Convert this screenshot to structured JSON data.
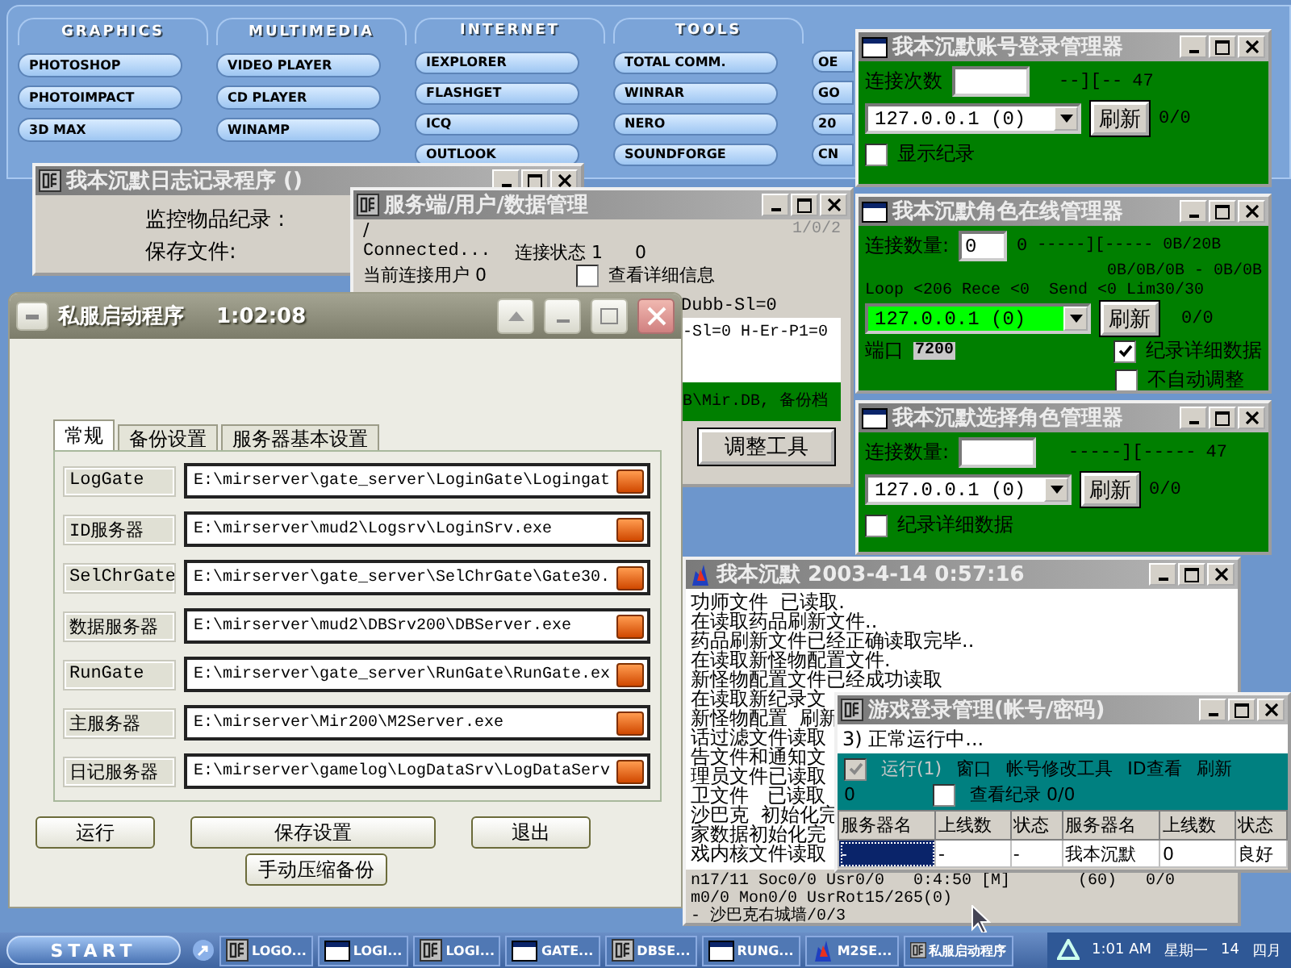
{
  "launcher_menu": [
    {
      "heading": "GRAPHICS",
      "items": [
        "PHOTOSHOP",
        "PHOTOIMPACT",
        "3D MAX"
      ]
    },
    {
      "heading": "MULTIMEDIA",
      "items": [
        "VIDEO PLAYER",
        "CD PLAYER",
        "WINAMP"
      ]
    },
    {
      "heading": "INTERNET",
      "items": [
        "IEXPLORER",
        "FLASHGET",
        "ICQ",
        "OUTLOOK"
      ]
    },
    {
      "heading": "TOOLS",
      "items": [
        "TOTAL COMM.",
        "WINRAR",
        "NERO",
        "SOUNDFORGE"
      ]
    },
    {
      "items": [
        "OE",
        "GO",
        "20",
        "CN"
      ]
    }
  ],
  "log_window": {
    "title": "我本沉默日志记录程序 ()",
    "labels": [
      "监控物品纪录 :",
      "保存文件:"
    ]
  },
  "server_window": {
    "title": "服务端/用户/数据管理",
    "path": "/",
    "counter": "1/0/2",
    "status": "Connected...",
    "connection_state": "连接状态 1",
    "connection_value": "0",
    "current_users": "当前连接用户 0",
    "detail_checkbox": {
      "label": "查看详细信息",
      "checked": false
    },
    "info_line": "Dubb-Sl=0",
    "memo_line": "-Sl=0 H-Er-P1=0",
    "backup_line": "B\\Mir.DB,  备份档",
    "tool_button": "调整工具"
  },
  "launcher_window": {
    "title": "私服启动程序",
    "clock": "1:02:08",
    "tabs": [
      {
        "label": "常规",
        "selected": true
      },
      {
        "label": "备份设置",
        "selected": false
      },
      {
        "label": "服务器基本设置",
        "selected": false
      }
    ],
    "rows": [
      {
        "label": "LogGate",
        "path": "E:\\mirserver\\gate_server\\LoginGate\\Logingat"
      },
      {
        "label": "ID服务器",
        "path": "E:\\mirserver\\mud2\\Logsrv\\LoginSrv.exe"
      },
      {
        "label": "SelChrGate",
        "path": "E:\\mirserver\\gate_server\\SelChrGate\\Gate30."
      },
      {
        "label": "数据服务器",
        "path": "E:\\mirserver\\mud2\\DBSrv200\\DBServer.exe"
      },
      {
        "label": "RunGate",
        "path": "E:\\mirserver\\gate_server\\RunGate\\RunGate.ex"
      },
      {
        "label": "主服务器",
        "path": "E:\\mirserver\\Mir200\\M2Server.exe"
      },
      {
        "label": "日记服务器",
        "path": "E:\\mirserver\\gamelog\\LogDataSrv\\LogDataServ"
      }
    ],
    "buttons": [
      "运行",
      "保存设置",
      "退出"
    ],
    "backup_button": "手动压缩备份"
  },
  "account_window": {
    "title": "我本沉默账号登录管理器",
    "count_label": "连接次数",
    "marker": "--][--",
    "marker_value": "47",
    "address": "127.0.0.1  (0)",
    "refresh": "刷新",
    "ratio": "0/0",
    "log_checkbox": {
      "label": "显示纪录",
      "checked": false
    }
  },
  "role_window": {
    "title": "我本沉默角色在线管理器",
    "count_label": "连接数量:",
    "count_value": "0",
    "count_extra": "0",
    "marker": "-----][----- 0B/20B",
    "traffic": "0B/0B/0B - 0B/0B",
    "loop_line": "Loop <206 Rece <0  Send <0 Lim30/30",
    "address": "127.0.0.1  (0)",
    "address_highlighted": true,
    "refresh": "刷新",
    "ratio": "0/0",
    "port_label": "端口",
    "port_value": "7200",
    "checkboxes": [
      {
        "label": "纪录详细数据",
        "checked": true
      },
      {
        "label": "不自动调整",
        "checked": false
      }
    ]
  },
  "select_window": {
    "title": "我本沉默选择角色管理器",
    "count_label": "连接数量:",
    "marker": "-----][-----",
    "marker_value": "47",
    "address": "127.0.0.1  (0)",
    "refresh": "刷新",
    "ratio": "0/0",
    "log_checkbox": {
      "label": "纪录详细数据",
      "checked": false
    }
  },
  "m2_window": {
    "title": "我本沉默 2003-4-14 0:57:16",
    "log_lines": [
      "功师文件  已读取.",
      "在读取药品刷新文件..",
      "药品刷新文件已经正确读取完毕..",
      "在读取新怪物配置文件.",
      "新怪物配置文件已经成功读取",
      "在读取新纪录文",
      "新怪物配置  刷新",
      "话过滤文件读取",
      "告文件和通知文",
      "理员文件已读取",
      "卫文件   已读取",
      "沙巴克  初始化完",
      "家数据初始化完",
      "戏内核文件读取"
    ],
    "status_lines": [
      "n17/11 Soc0/0 Usr0/0   0:4:50 [M]       (60)   0/0",
      "m0/0 Mon0/0 UsrRot15/265(0)",
      "- 沙巴克右城墙/0/3"
    ]
  },
  "game_login_window": {
    "title": "游戏登录管理(帐号/密码)",
    "status": "3) 正常运行中...",
    "run_checkbox": {
      "label": "运行(1)",
      "checked": true,
      "disabled": true
    },
    "menu": [
      "窗口",
      "帐号修改工具",
      "ID查看",
      "刷新"
    ],
    "count": "0",
    "log_checkbox": {
      "label": "查看纪录 0/0",
      "checked": false
    },
    "table": {
      "columns": [
        "服务器名",
        "上线数",
        "状态",
        "服务器名",
        "上线数",
        "状态"
      ],
      "rows": [
        {
          "cells": [
            "-",
            "-",
            "-",
            "我本沉默",
            "0",
            "良好"
          ],
          "selected": true
        }
      ]
    }
  },
  "taskbar": {
    "start": "START",
    "tasks": [
      {
        "label": "LOGO...",
        "kind": "emblem"
      },
      {
        "label": "LOGI...",
        "kind": "window"
      },
      {
        "label": "LOGI...",
        "kind": "emblem"
      },
      {
        "label": "GATE...",
        "kind": "window"
      },
      {
        "label": "DBSE...",
        "kind": "emblem"
      },
      {
        "label": "RUNG...",
        "kind": "window"
      },
      {
        "label": "M2SE...",
        "kind": "flame"
      },
      {
        "label": "私服启动程序",
        "kind": "emblem"
      }
    ],
    "clock": "1:01 AM",
    "day": "星期一",
    "date": "14",
    "month": "四月"
  }
}
